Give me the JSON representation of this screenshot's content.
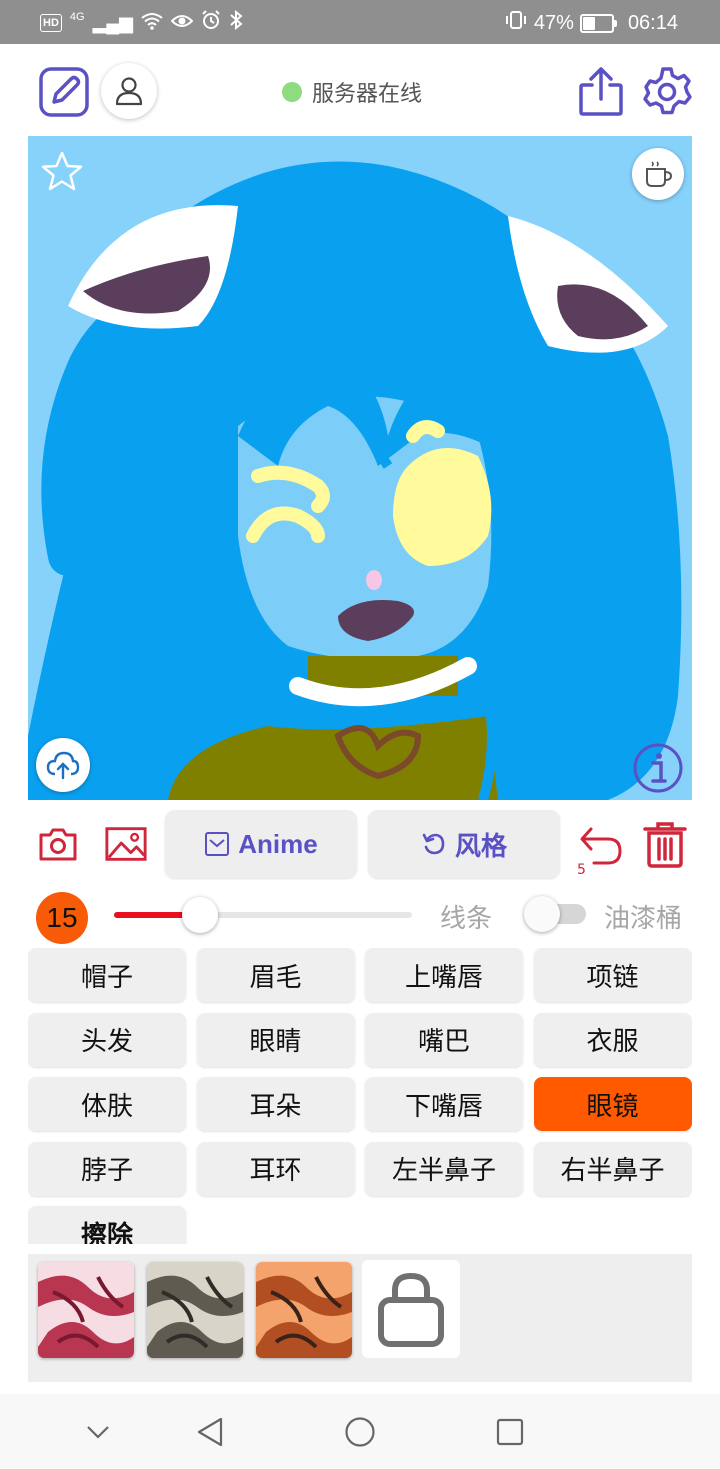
{
  "status_bar": {
    "hd": "HD",
    "network": "4G",
    "battery_percent": "47%",
    "battery_level": 0.47,
    "time": "06:14"
  },
  "header": {
    "server_status": "服务器在线",
    "server_status_color": "#8fdc80"
  },
  "canvas": {
    "background_color": "#87d2fb"
  },
  "toolbar": {
    "anime_label": "Anime",
    "style_label": "风格",
    "undo_count": "5",
    "accent_color": "#5a52c4",
    "tool_color": "#d0263b"
  },
  "brush": {
    "size": "15",
    "slider_value": 0.29,
    "lines_label": "线条",
    "bucket_label": "油漆桶",
    "bucket_enabled": false
  },
  "parts": [
    {
      "label": "帽子",
      "active": false
    },
    {
      "label": "眉毛",
      "active": false
    },
    {
      "label": "上嘴唇",
      "active": false
    },
    {
      "label": "项链",
      "active": false
    },
    {
      "label": "头发",
      "active": false
    },
    {
      "label": "眼睛",
      "active": false
    },
    {
      "label": "嘴巴",
      "active": false
    },
    {
      "label": "衣服",
      "active": false
    },
    {
      "label": "体肤",
      "active": false
    },
    {
      "label": "耳朵",
      "active": false
    },
    {
      "label": "下嘴唇",
      "active": false
    },
    {
      "label": "眼镜",
      "active": true
    },
    {
      "label": "脖子",
      "active": false
    },
    {
      "label": "耳环",
      "active": false
    },
    {
      "label": "左半鼻子",
      "active": false
    },
    {
      "label": "右半鼻子",
      "active": false
    },
    {
      "label": "擦除",
      "active": false
    }
  ],
  "active_part_color": "#ff5a00",
  "style_thumbs": [
    {
      "name": "style-crimson",
      "colors": [
        "#f6dde3",
        "#b8364f",
        "#7a1830"
      ]
    },
    {
      "name": "style-grey",
      "colors": [
        "#d8d4c8",
        "#5f5b50",
        "#2f2d28"
      ]
    },
    {
      "name": "style-orange",
      "colors": [
        "#f4a36c",
        "#b24f22",
        "#3a2218"
      ]
    }
  ]
}
